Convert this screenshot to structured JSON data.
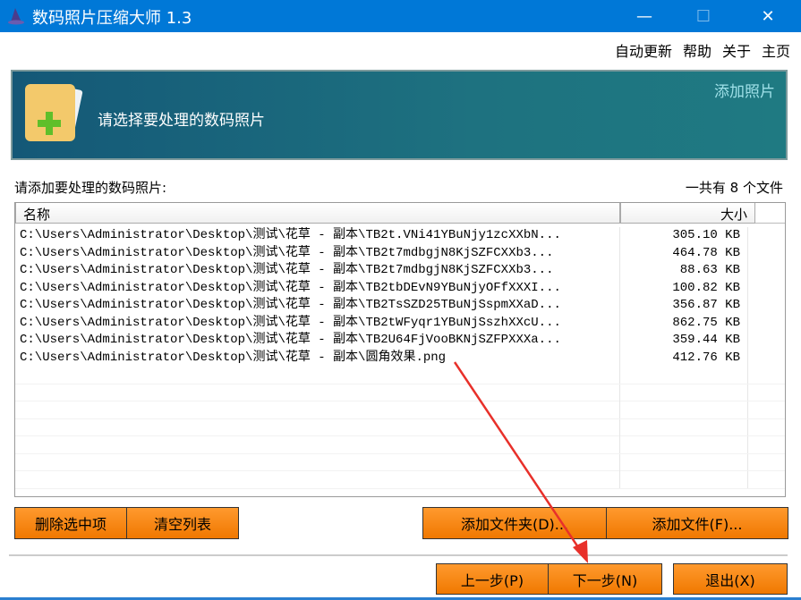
{
  "window": {
    "title": "数码照片压缩大师 1.3"
  },
  "menu": [
    "自动更新",
    "帮助",
    "关于",
    "主页"
  ],
  "banner": {
    "text": "请选择要处理的数码照片",
    "link": "添加照片"
  },
  "list": {
    "label": "请添加要处理的数码照片:",
    "count": "一共有 8 个文件",
    "columns": [
      "名称",
      "大小"
    ],
    "rows": [
      {
        "name": "C:\\Users\\Administrator\\Desktop\\测试\\花草 - 副本\\TB2t.VNi41YBuNjy1zcXXbN...",
        "size": "305.10 KB"
      },
      {
        "name": "C:\\Users\\Administrator\\Desktop\\测试\\花草 - 副本\\TB2t7mdbgjN8KjSZFCXXb3...",
        "size": "464.78 KB"
      },
      {
        "name": "C:\\Users\\Administrator\\Desktop\\测试\\花草 - 副本\\TB2t7mdbgjN8KjSZFCXXb3...",
        "size": "88.63 KB"
      },
      {
        "name": "C:\\Users\\Administrator\\Desktop\\测试\\花草 - 副本\\TB2tbDEvN9YBuNjyOFfXXXI...",
        "size": "100.82 KB"
      },
      {
        "name": "C:\\Users\\Administrator\\Desktop\\测试\\花草 - 副本\\TB2TsSZD25TBuNjSspmXXaD...",
        "size": "356.87 KB"
      },
      {
        "name": "C:\\Users\\Administrator\\Desktop\\测试\\花草 - 副本\\TB2tWFyqr1YBuNjSszhXXcU...",
        "size": "862.75 KB"
      },
      {
        "name": "C:\\Users\\Administrator\\Desktop\\测试\\花草 - 副本\\TB2U64FjVooBKNjSZFPXXXa...",
        "size": "359.44 KB"
      },
      {
        "name": "C:\\Users\\Administrator\\Desktop\\测试\\花草 - 副本\\圆角效果.png",
        "size": "412.76 KB"
      }
    ]
  },
  "buttons": {
    "delete": "删除选中项",
    "clear": "清空列表",
    "add_folder": "添加文件夹(D)...",
    "add_file": "添加文件(F)...",
    "prev": "上一步(P)",
    "next": "下一步(N)",
    "exit": "退出(X)"
  },
  "colors": {
    "titlebar": "#0078d7",
    "button": "#f58a14",
    "annotation_arrow": "#e8302a"
  }
}
